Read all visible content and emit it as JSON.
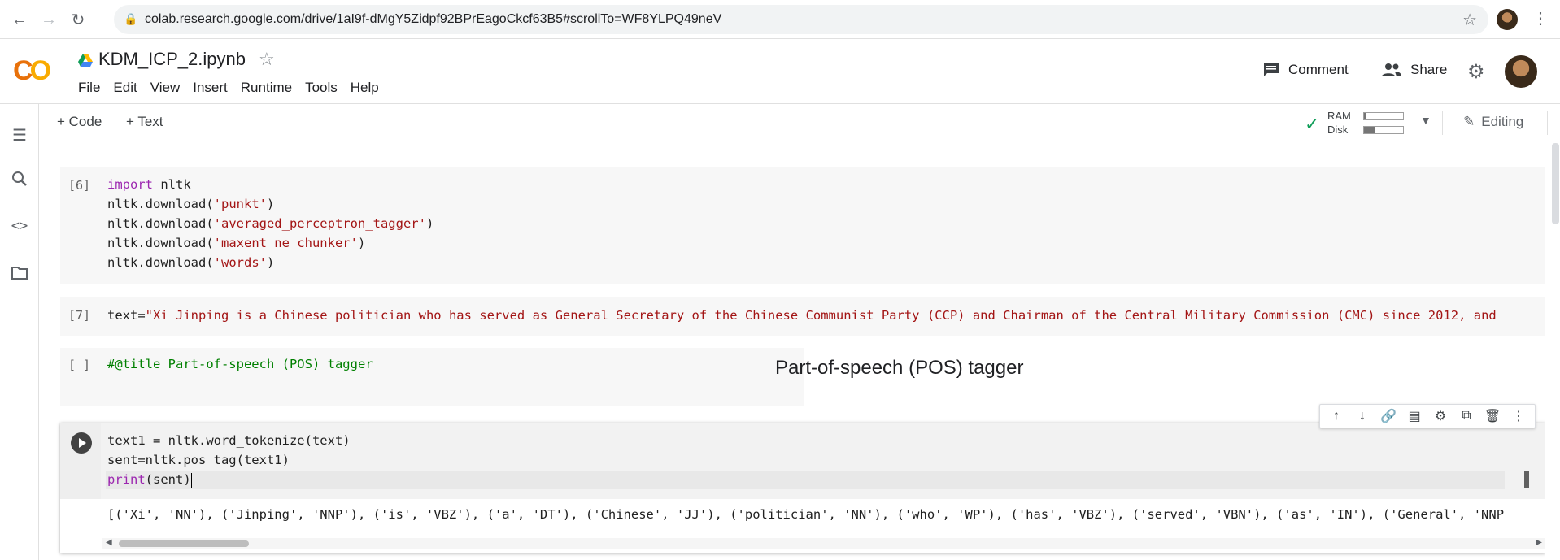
{
  "browser": {
    "url": "colab.research.google.com/drive/1aI9f-dMgY5Zidpf92BPrEagoCkcf63B5#scrollTo=WF8YLPQ49neV"
  },
  "header": {
    "logo": "CO",
    "notebook_title": "KDM_ICP_2.ipynb",
    "menu": [
      "File",
      "Edit",
      "View",
      "Insert",
      "Runtime",
      "Tools",
      "Help"
    ],
    "comment_label": "Comment",
    "share_label": "Share"
  },
  "toolbar": {
    "add_code": "Code",
    "add_text": "Text",
    "ram_label": "RAM",
    "disk_label": "Disk",
    "ram_fraction": 0.05,
    "disk_fraction": 0.3,
    "editing_label": "Editing"
  },
  "cells": {
    "c6": {
      "prompt": "[6]",
      "lines": [
        {
          "kw": "import",
          "rest": " nltk"
        },
        {
          "pre": "nltk.download(",
          "str": "'punkt'",
          "post": ")"
        },
        {
          "pre": "nltk.download(",
          "str": "'averaged_perceptron_tagger'",
          "post": ")"
        },
        {
          "pre": "nltk.download(",
          "str": "'maxent_ne_chunker'",
          "post": ")"
        },
        {
          "pre": "nltk.download(",
          "str": "'words'",
          "post": ")"
        }
      ]
    },
    "c7": {
      "prompt": "[7]",
      "pre": "text=",
      "str": "\"Xi Jinping is a Chinese politician who has served as General Secretary of the Chinese Communist Party (CCP) and Chairman of the Central Military Commission (CMC) since 2012, and"
    },
    "form": {
      "prompt": "[ ]",
      "code": "#@title Part-of-speech (POS) tagger",
      "title": "Part-of-speech (POS) tagger"
    },
    "active": {
      "line1": "text1 = nltk.word_tokenize(text)",
      "line2": "sent=nltk.pos_tag(text1)",
      "line3_fn": "print",
      "line3_rest": "(sent)",
      "output": "[('Xi', 'NN'), ('Jinping', 'NNP'), ('is', 'VBZ'), ('a', 'DT'), ('Chinese', 'JJ'), ('politician', 'NN'), ('who', 'WP'), ('has', 'VBZ'), ('served', 'VBN'), ('as', 'IN'), ('General', 'NNP"
    }
  },
  "cell_toolbar_icons": [
    "arrow-up-icon",
    "arrow-down-icon",
    "link-icon",
    "comment-icon",
    "gear-icon",
    "mirror-icon",
    "trash-icon",
    "more-vert-icon"
  ]
}
